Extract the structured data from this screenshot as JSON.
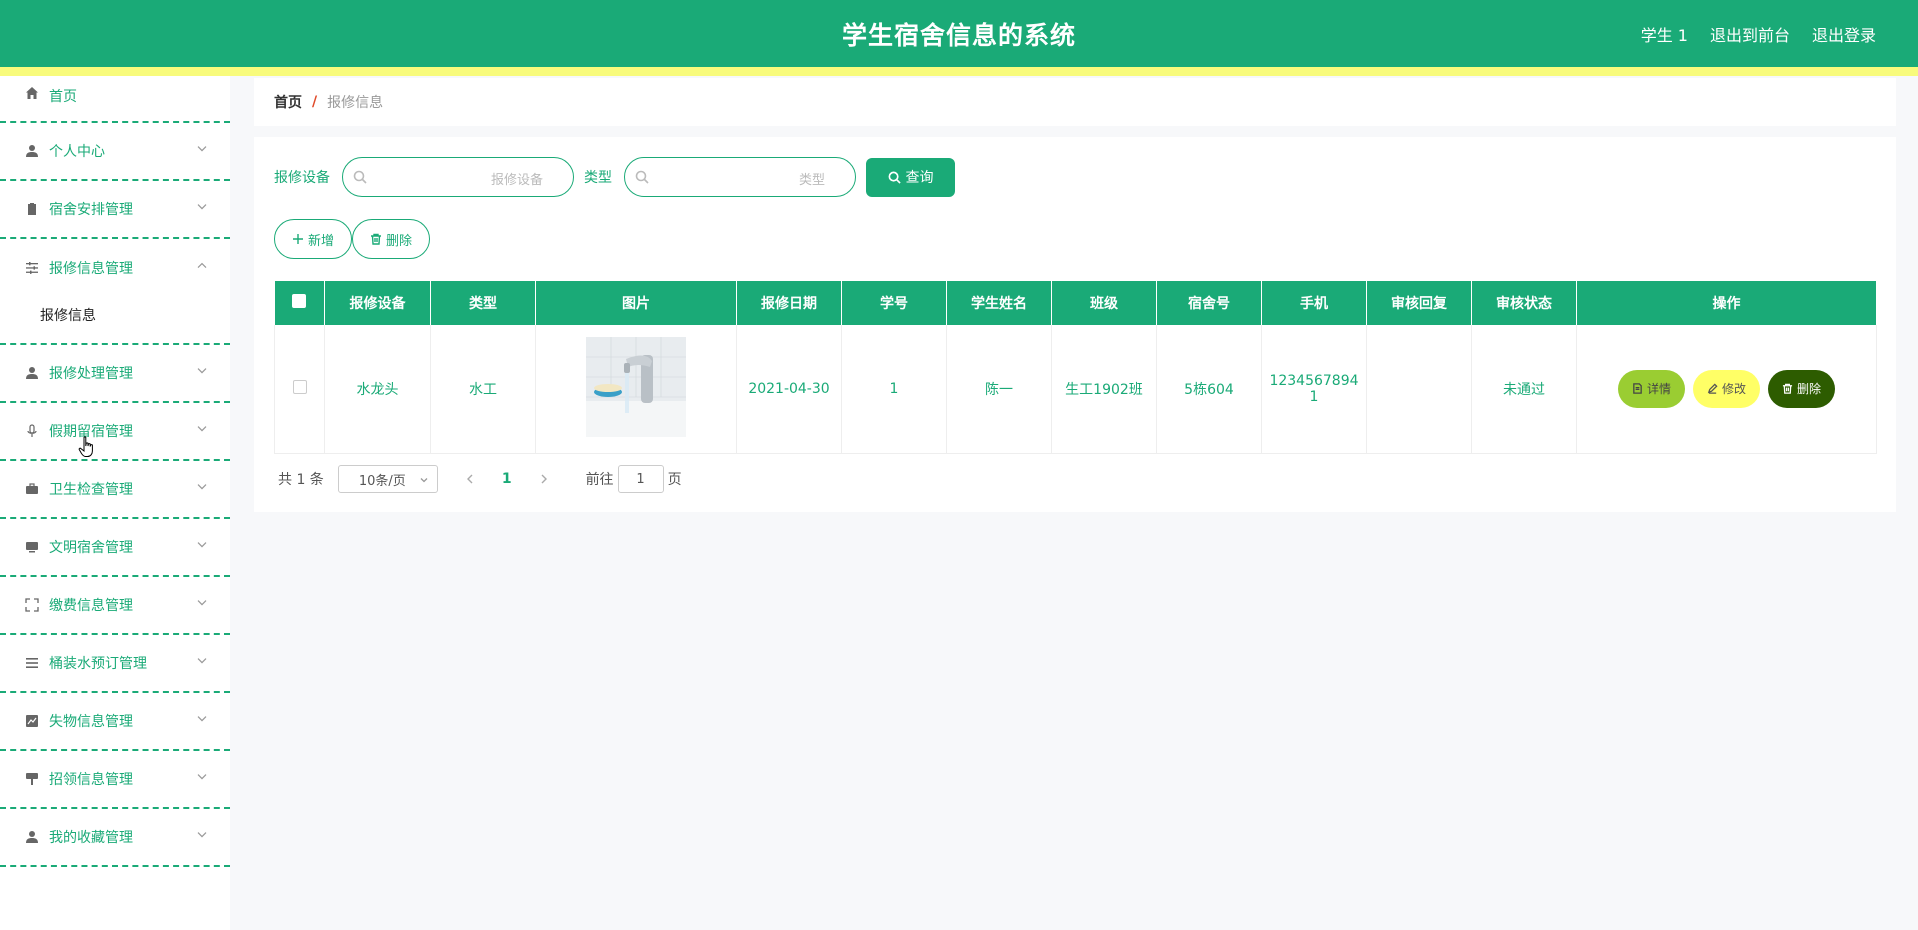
{
  "header": {
    "title": "学生宿舍信息的系统",
    "user": "学生 1",
    "to_front": "退出到前台",
    "logout": "退出登录",
    "bg_color": "#1aaa77",
    "stripe_color": "#f8fb7c"
  },
  "sidebar": {
    "items": [
      {
        "label": "首页",
        "icon": "home-icon"
      },
      {
        "label": "个人中心",
        "icon": "user-icon"
      },
      {
        "label": "宿舍安排管理",
        "icon": "clipboard-icon"
      },
      {
        "label": "报修信息管理",
        "icon": "sliders-icon",
        "open": true,
        "sub": "报修信息"
      },
      {
        "label": "报修处理管理",
        "icon": "user-icon"
      },
      {
        "label": "假期留宿管理",
        "icon": "mic-icon"
      },
      {
        "label": "卫生检查管理",
        "icon": "briefcase-icon"
      },
      {
        "label": "文明宿舍管理",
        "icon": "monitor-icon"
      },
      {
        "label": "缴费信息管理",
        "icon": "fullscreen-icon"
      },
      {
        "label": "桶装水预订管理",
        "icon": "list-icon"
      },
      {
        "label": "失物信息管理",
        "icon": "chart-icon"
      },
      {
        "label": "招领信息管理",
        "icon": "brush-icon"
      },
      {
        "label": "我的收藏管理",
        "icon": "person-icon"
      }
    ]
  },
  "breadcrumb": {
    "home": "首页",
    "sep": "/",
    "current": "报修信息"
  },
  "search": {
    "label1": "报修设备",
    "placeholder1": "报修设备",
    "label2": "类型",
    "placeholder2": "类型",
    "query": "查询"
  },
  "actions": {
    "add": "新增",
    "delete": "删除"
  },
  "table": {
    "headers": [
      "报修设备",
      "类型",
      "图片",
      "报修日期",
      "学号",
      "学生姓名",
      "班级",
      "宿舍号",
      "手机",
      "审核回复",
      "审核状态",
      "操作"
    ],
    "rows": [
      {
        "device": "水龙头",
        "type": "水工",
        "date": "2021-04-30",
        "student_no": "1",
        "name": "陈一",
        "class": "生工1902班",
        "dorm": "5栋604",
        "phone_line1": "1234567894",
        "phone_line2": "1",
        "reply": "",
        "status": "未通过",
        "btn_detail": "详情",
        "btn_edit": "修改",
        "btn_delete": "删除"
      }
    ]
  },
  "pager": {
    "total": "共 1 条",
    "page_size": "10条/页",
    "current": "1",
    "goto": "前往",
    "goto_value": "1",
    "page_unit": "页"
  }
}
